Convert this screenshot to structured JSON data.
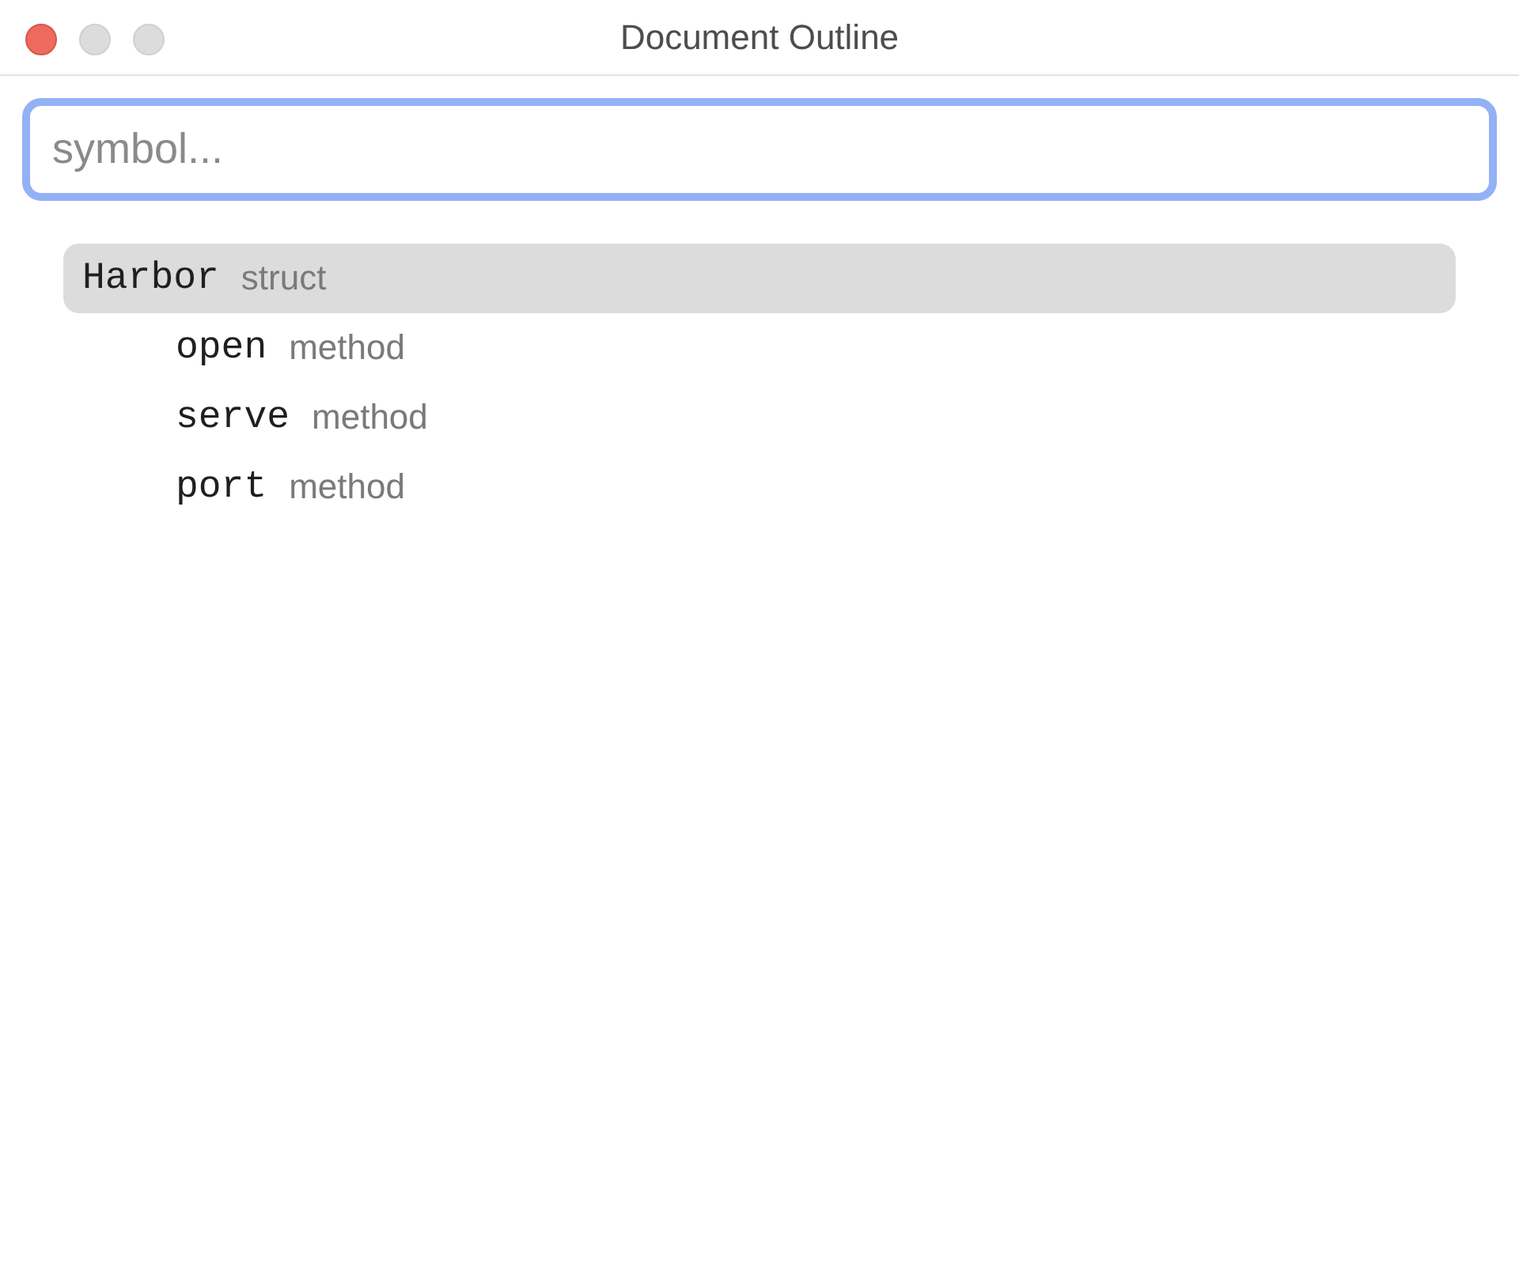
{
  "window": {
    "title": "Document Outline",
    "controls": [
      {
        "kind": "close",
        "disabled": false
      },
      {
        "kind": "minimize",
        "disabled": true
      },
      {
        "kind": "zoom",
        "disabled": true
      }
    ]
  },
  "search": {
    "placeholder": "symbol...",
    "focused": true
  },
  "outline": [
    {
      "name": "Harbor",
      "symbol_type": "struct",
      "selected": true,
      "children": [
        {
          "name": "open",
          "symbol_type": "method",
          "selected": false
        },
        {
          "name": "serve",
          "symbol_type": "method",
          "selected": false
        },
        {
          "name": "port",
          "symbol_type": "method",
          "selected": false
        }
      ]
    }
  ]
}
